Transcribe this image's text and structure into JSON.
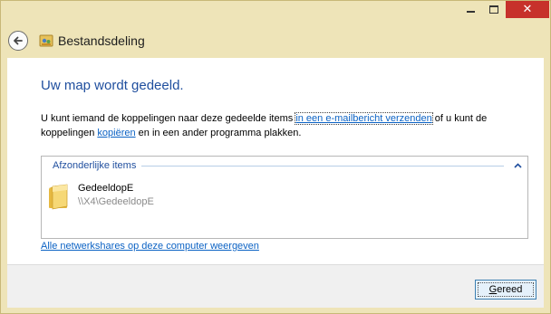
{
  "window": {
    "title": "Bestandsdeling",
    "controls": {
      "minimize_icon": "minimize-icon",
      "maximize_icon": "maximize-icon",
      "close_glyph": "✕"
    },
    "accent_close": "#c7312b",
    "frame_color": "#eee4b8"
  },
  "heading": "Uw map wordt gedeeld.",
  "description": {
    "part1": "U kunt iemand de koppelingen naar deze gedeelde items ",
    "email_link": "in een e-mailbericht verzenden",
    "part2": " of u kunt de koppelingen ",
    "copy_link": "kopiëren",
    "part3": " en in een ander programma plakken."
  },
  "items_group": {
    "label": "Afzonderlijke items",
    "items": [
      {
        "name": "GedeeldopE",
        "path": "\\\\X4\\GedeeldopE",
        "icon": "folder-icon"
      }
    ]
  },
  "network_link": "Alle netwerkshares op deze computer weergeven",
  "footer": {
    "done_label_first": "G",
    "done_label_rest": "ereed"
  }
}
